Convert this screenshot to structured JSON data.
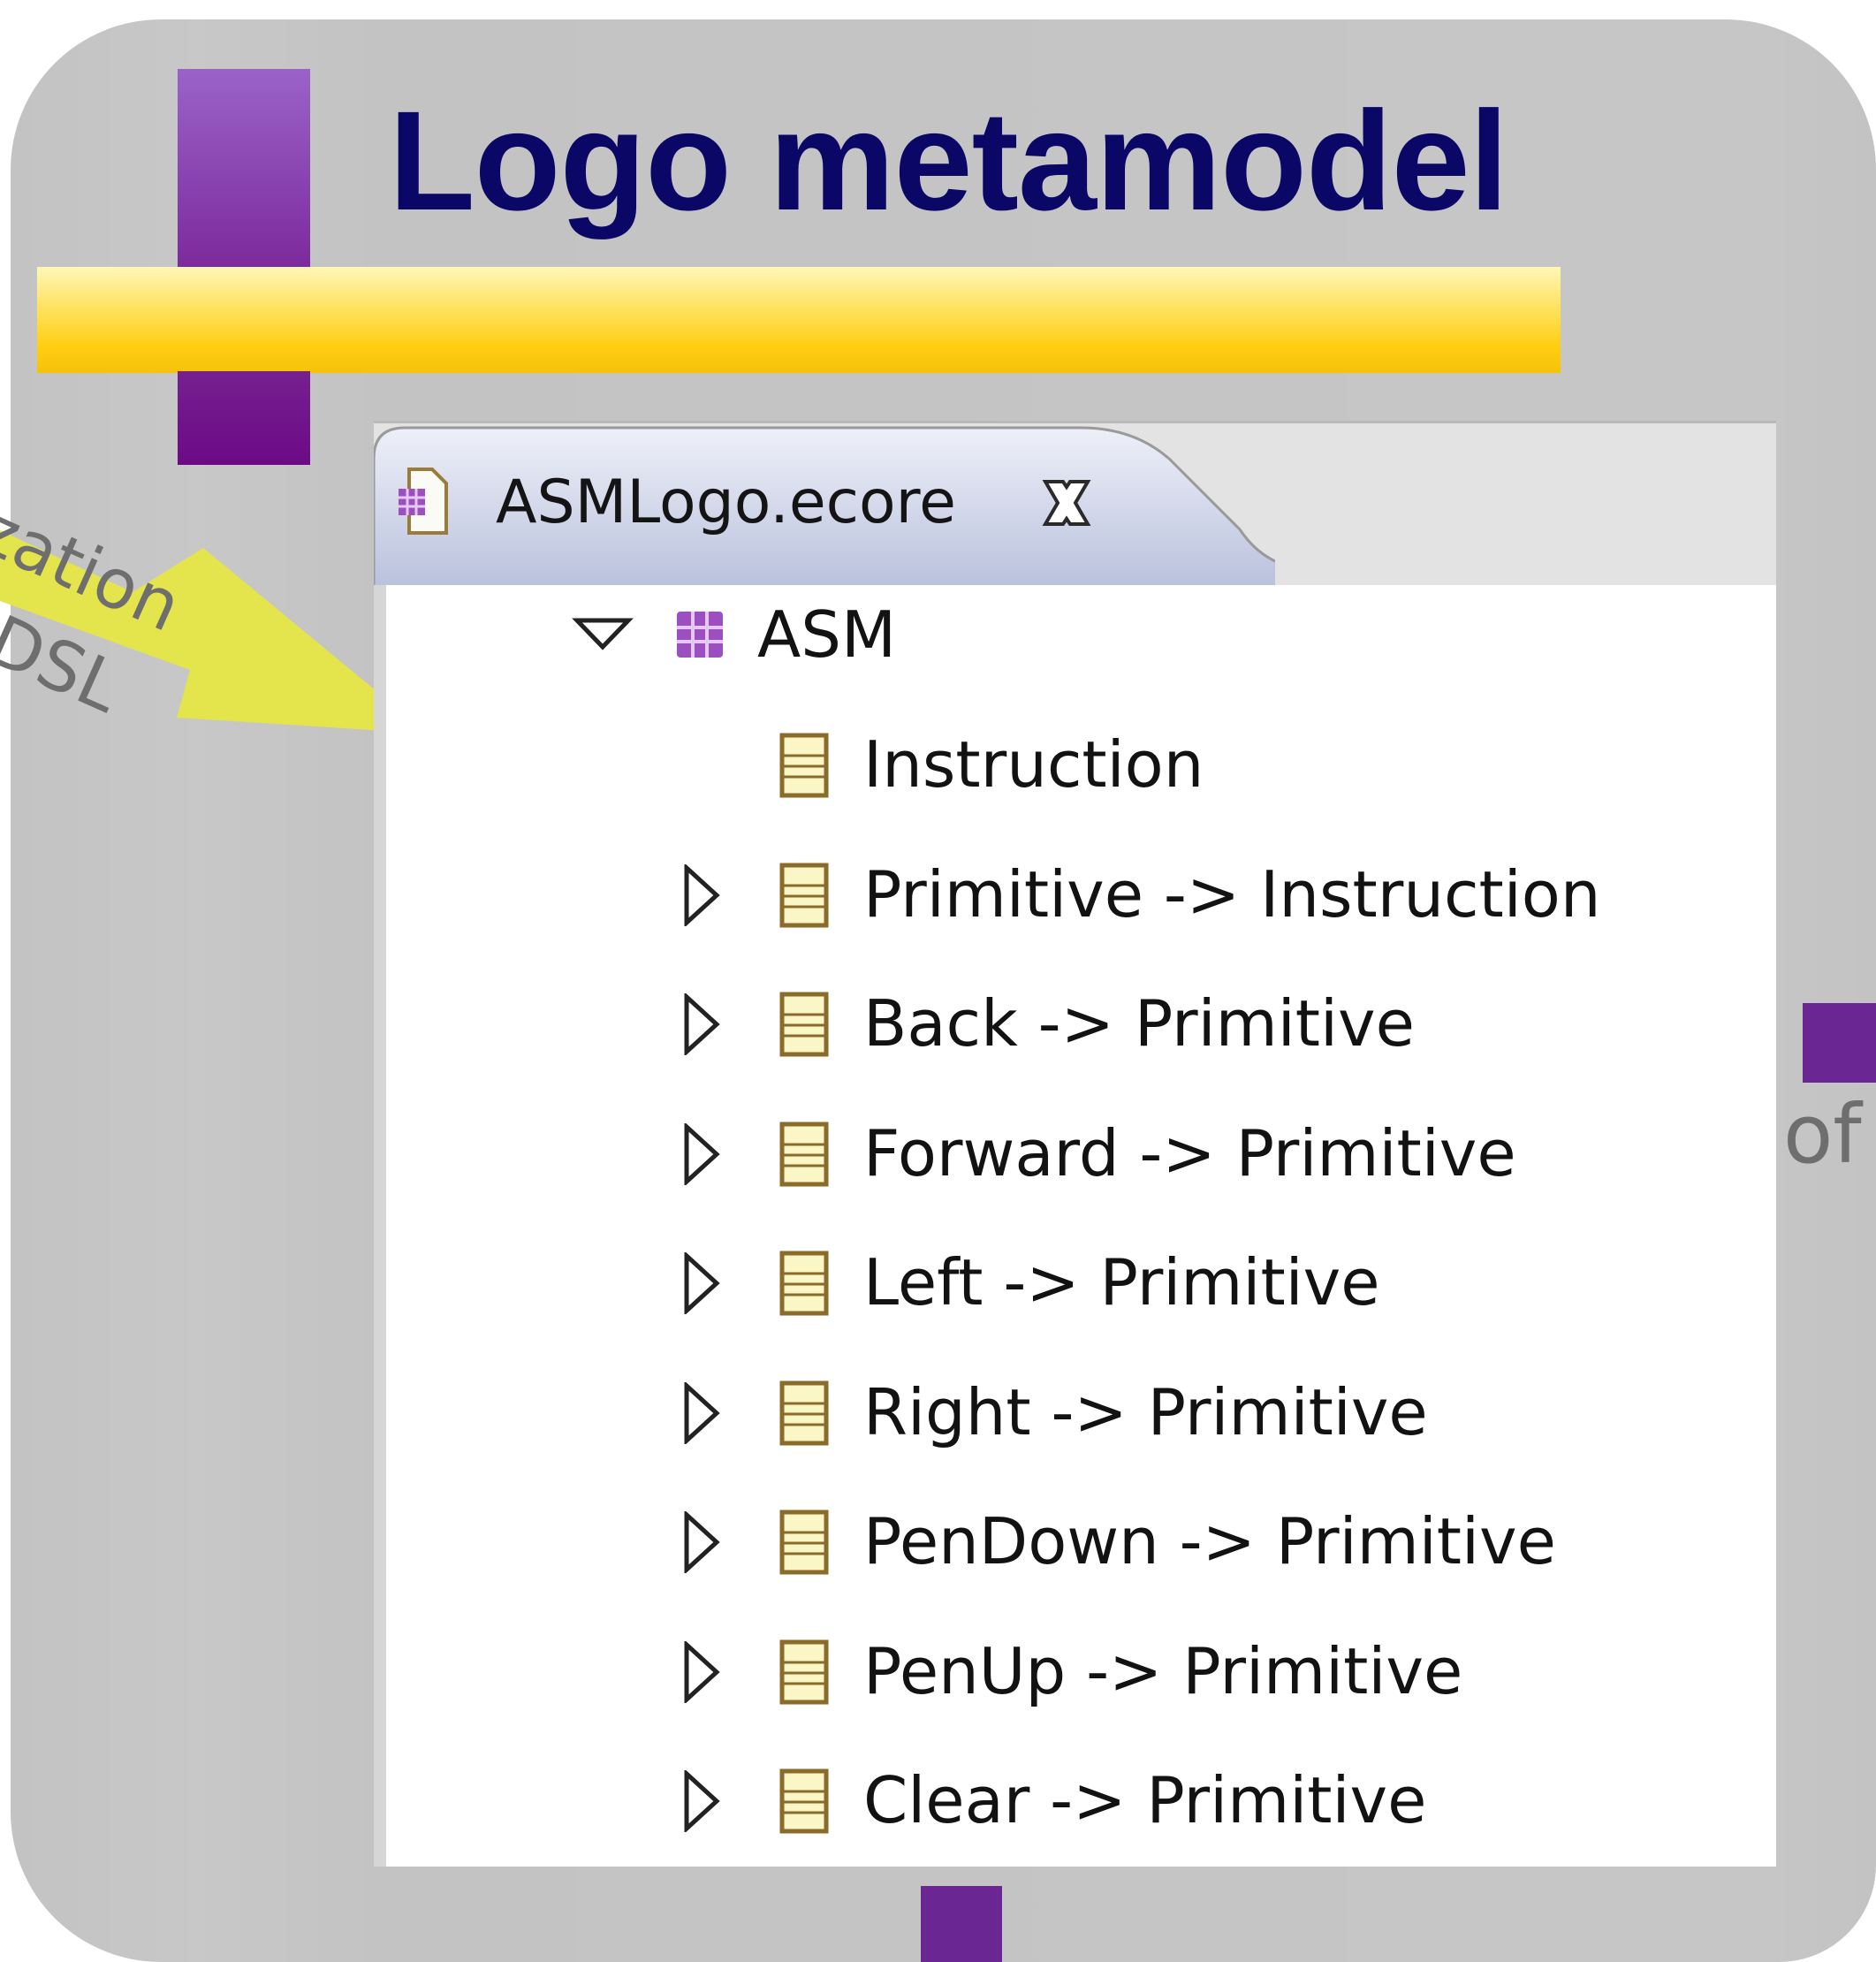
{
  "slide": {
    "title": "Logo metamodel",
    "arrow_text_line1": "ization",
    "arrow_text_line2": "DSL",
    "side_text": "of"
  },
  "editor": {
    "tab": {
      "label": "ASMLogo.ecore",
      "file_icon": "ecore-file-icon",
      "close_icon": "close-icon"
    },
    "tree": {
      "root": {
        "label": "ASM",
        "icon": "package-icon",
        "expanded": true
      },
      "items": [
        {
          "label": "Instruction",
          "icon": "eclass-icon",
          "expandable": false
        },
        {
          "label": "Primitive -> Instruction",
          "icon": "eclass-icon",
          "expandable": true
        },
        {
          "label": "Back -> Primitive",
          "icon": "eclass-icon",
          "expandable": true
        },
        {
          "label": "Forward -> Primitive",
          "icon": "eclass-icon",
          "expandable": true
        },
        {
          "label": "Left -> Primitive",
          "icon": "eclass-icon",
          "expandable": true
        },
        {
          "label": "Right -> Primitive",
          "icon": "eclass-icon",
          "expandable": true
        },
        {
          "label": "PenDown -> Primitive",
          "icon": "eclass-icon",
          "expandable": true
        },
        {
          "label": "PenUp -> Primitive",
          "icon": "eclass-icon",
          "expandable": true
        },
        {
          "label": "Clear -> Primitive",
          "icon": "eclass-icon",
          "expandable": true
        }
      ]
    }
  },
  "colors": {
    "slide_background": "#c3c3c3",
    "title": "#0b0767",
    "accent_purple": "#7c2a9c",
    "band_yellow": "#ffce12",
    "arrow_yellow": "#e4e44c",
    "tab_selected": "#c5cde6"
  }
}
